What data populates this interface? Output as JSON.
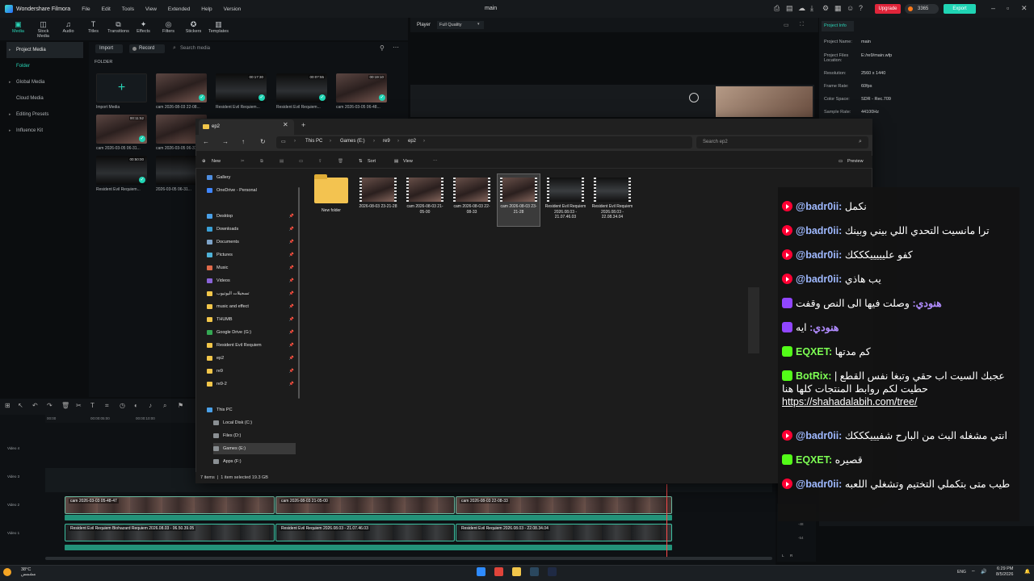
{
  "app": {
    "name": "Wondershare Filmora",
    "menu": [
      "File",
      "Edit",
      "Tools",
      "View",
      "Extended",
      "Help",
      "Version"
    ],
    "project_title": "main",
    "upgrade": "Upgrade",
    "credits": "3365",
    "export": "Export"
  },
  "toolbar": [
    "Media",
    "Stock Media",
    "Audio",
    "Titles",
    "Transitions",
    "Effects",
    "Filters",
    "Stickers",
    "Templates"
  ],
  "sidenav": [
    "Project Media",
    "Folder",
    "Global Media",
    "Cloud Media",
    "Editing Presets",
    "Influence Kit"
  ],
  "media": {
    "import": "Import",
    "record": "Record",
    "search_placeholder": "Search media",
    "folder_label": "FOLDER",
    "import_media": "Import Media",
    "items": [
      {
        "label": "cam 2026-08-03 22-08...",
        "dur": "",
        "kind": "cam"
      },
      {
        "label": "Resident Evil Requiem...",
        "dur": "00:17:30",
        "kind": "game"
      },
      {
        "label": "Resident Evil Requiem...",
        "dur": "00:07:55",
        "kind": "game"
      },
      {
        "label": "cam 2026-03-05 06-48...",
        "dur": "00:19:10",
        "kind": "cam"
      },
      {
        "label": "cam 2026-03-05 06-31...",
        "dur": "00:11:52",
        "kind": "cam"
      },
      {
        "label": "cam 2026-03-05 06-31...",
        "dur": "",
        "kind": "cam"
      },
      {
        "label": "Resident Evil Requiem...",
        "dur": "00:50:00",
        "kind": "game"
      },
      {
        "label": "2026-03-05 06-31...",
        "dur": "",
        "kind": "game"
      }
    ]
  },
  "player": {
    "label": "Player",
    "quality": "Full Quality"
  },
  "project_info": {
    "tab": "Project Info",
    "rows": [
      {
        "k": "Project Name:",
        "v": "main"
      },
      {
        "k": "Project Files Location:",
        "v": "E:/re9/main.wfp"
      },
      {
        "k": "Resolution:",
        "v": "2560 x 1440"
      },
      {
        "k": "Frame Rate:",
        "v": "60fps"
      },
      {
        "k": "Color Space:",
        "v": "SDR - Rec.709"
      },
      {
        "k": "Sample Rate:",
        "v": "44100Hz"
      }
    ]
  },
  "timeline": {
    "ruler": [
      "00:00",
      "00:00:05:00",
      "00:00:10:00"
    ],
    "tracks": [
      "Video 4",
      "Video 3",
      "Video 2",
      "Video 1"
    ],
    "v2_clips": [
      "cam 2026-03-03 05-48-47",
      "cam 2026-08-03 21-05-00",
      "cam 2026-08-03 22-08-33"
    ],
    "v1_clips": [
      "Resident Evil Requiem Biohazard Requiem 2026.08.03 - 06.50.39.05",
      "Resident Evil Requiem 2026.08.03 - 21.07.46.03",
      "Resident Evil Requiem 2026.08.03 - 22.08.34.04"
    ],
    "meter_labels": [
      "-48",
      "-54",
      "L",
      "R"
    ]
  },
  "explorer": {
    "tab": "ep2",
    "breadcrumb": [
      "This PC",
      "Games (E:)",
      "re9",
      "ep2"
    ],
    "search_placeholder": "Search ep2",
    "commands": [
      "New",
      "Sort",
      "View",
      "Preview"
    ],
    "nav": [
      {
        "label": "Gallery",
        "color": "#4f8ee0",
        "pin": false
      },
      {
        "label": "OneDrive - Personal",
        "color": "#3f86ff",
        "pin": false
      },
      {
        "label": "Desktop",
        "color": "#4aa0e8",
        "pin": true
      },
      {
        "label": "Downloads",
        "color": "#3aa0d6",
        "pin": true
      },
      {
        "label": "Documents",
        "color": "#7fa4c9",
        "pin": true
      },
      {
        "label": "Pictures",
        "color": "#4fb2d8",
        "pin": true
      },
      {
        "label": "Music",
        "color": "#e06a4a",
        "pin": true
      },
      {
        "label": "Videos",
        "color": "#8a64d8",
        "pin": true
      },
      {
        "label": "تسجيلات اليوتيوب",
        "color": "#f2c64a",
        "pin": true
      },
      {
        "label": "music and effect",
        "color": "#f2c64a",
        "pin": true
      },
      {
        "label": "THUMB",
        "color": "#f2c64a",
        "pin": true
      },
      {
        "label": "Google Drive (G:)",
        "color": "#34a853",
        "pin": true
      },
      {
        "label": "Resident Evil Requiem",
        "color": "#f2c64a",
        "pin": true
      },
      {
        "label": "ep2",
        "color": "#f2c64a",
        "pin": true
      },
      {
        "label": "re9",
        "color": "#f2c64a",
        "pin": true
      },
      {
        "label": "re9-2",
        "color": "#f2c64a",
        "pin": true
      }
    ],
    "pc": [
      {
        "label": "This PC",
        "color": "#4aa0e8"
      },
      {
        "label": "Local Disk (C:)",
        "color": "#8a8f93"
      },
      {
        "label": "Files (D:)",
        "color": "#8a8f93"
      },
      {
        "label": "Games (E:)",
        "color": "#8a8f93"
      },
      {
        "label": "Apps (F:)",
        "color": "#8a8f93"
      }
    ],
    "files": [
      {
        "name": "New folder",
        "kind": "folder"
      },
      {
        "name": "2026-08-03 23-21-28",
        "kind": "cam"
      },
      {
        "name": "cam 2026-08-03 21-05-00",
        "kind": "cam"
      },
      {
        "name": "cam 2026-08-03 22-08-33",
        "kind": "cam"
      },
      {
        "name": "cam 2026-08-03 23-21-28",
        "kind": "cam"
      },
      {
        "name": "Resident Evil Requiem 2026.08.03 - 21.07.46.03",
        "kind": "game"
      },
      {
        "name": "Resident Evil Requiem 2026.08.03 - 22.08.34.04",
        "kind": "game"
      }
    ],
    "status_count": "7 items",
    "status_selected": "1 item selected 19.3 GB"
  },
  "chat": [
    {
      "src": "yt",
      "user": "@badr0ii:",
      "msg": "نكمل"
    },
    {
      "src": "yt",
      "user": "@badr0ii:",
      "msg": "ترا مانسيت التحدي اللي بيني وبينك"
    },
    {
      "src": "yt",
      "user": "@badr0ii:",
      "msg": "كفو عليييييكككك"
    },
    {
      "src": "yt",
      "user": "@badr0ii:",
      "msg": "يب هاذي"
    },
    {
      "src": "tw",
      "user": "هنودي:",
      "msg": "وصلت فيها الى النص وقفت"
    },
    {
      "src": "tw",
      "user": "هنودي:",
      "msg": "ايه"
    },
    {
      "src": "kk",
      "user": "EQXET:",
      "msg": "كم مدتها"
    },
    {
      "src": "kk",
      "user": "BotRix:",
      "msg": "عجبك السيت اب حقي وتبغا نفس القطع | حطيت لكم روابط المنتجات كلها هنا",
      "link": "https://shahadalabih.com/tree/"
    },
    {
      "src": "yt",
      "user": "@badr0ii:",
      "msg": "انتي مشغله البث من البارح شفيييكككك"
    },
    {
      "src": "kk",
      "user": "EQXET:",
      "msg": "قصيره"
    },
    {
      "src": "yt",
      "user": "@badr0ii:",
      "msg": "طيب متى بتكملي التختيم وتشغلي اللعبه"
    }
  ],
  "taskbar": {
    "temp": "38°C",
    "weather": "مشمس",
    "lang": "ENG",
    "time": "6:29 PM",
    "date": "8/5/2026"
  }
}
